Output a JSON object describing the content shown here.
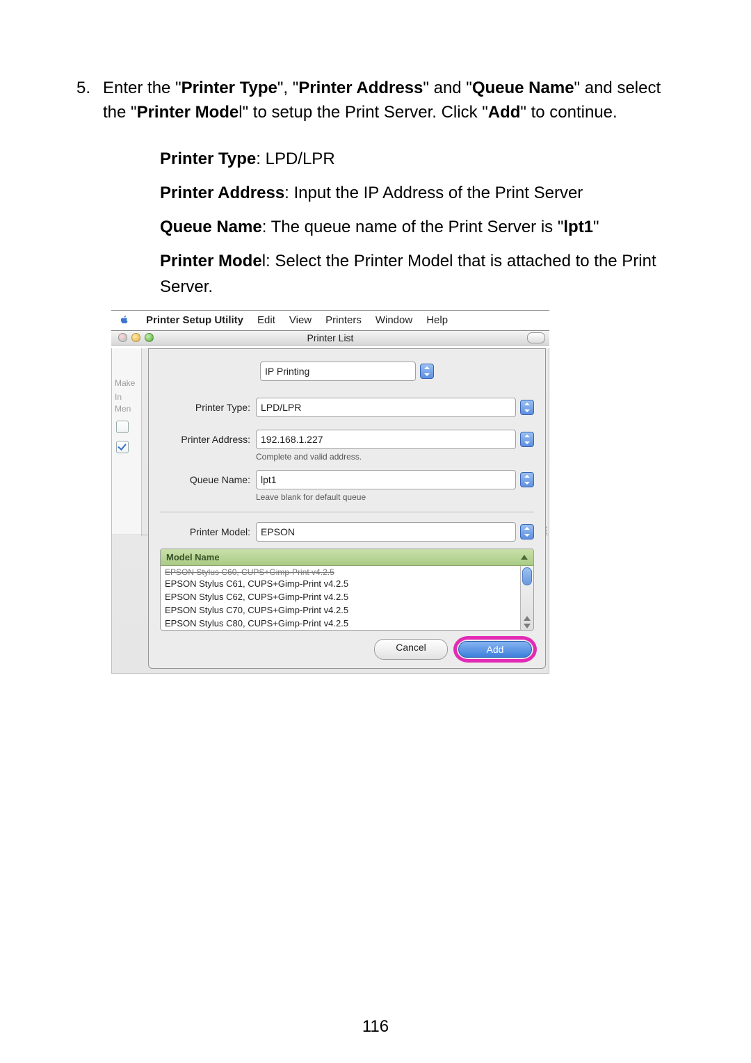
{
  "step": {
    "number": "5.",
    "text_parts": {
      "t0": "Enter the \"",
      "b1": "Printer Type",
      "t1": "\", \"",
      "b2": "Printer Address",
      "t2": "\" and \"",
      "b3": "Queue Name",
      "t3": "\" and select the \"",
      "b4": "Printer Mode",
      "t4": "l\" to setup the Print Server. Click \"",
      "b5": "Add",
      "t5": "\" to continue."
    }
  },
  "defs": {
    "printer_type": {
      "label": "Printer Type",
      "value": ": LPD/LPR"
    },
    "printer_address": {
      "label": "Printer Address",
      "value": ": Input the IP Address of the Print Server"
    },
    "queue_name": {
      "label": "Queue Name",
      "value_a": ": The queue name of the Print Server is \"",
      "value_b": "lpt1",
      "value_c": "\""
    },
    "printer_model": {
      "label": "Printer Mode",
      "value": "l: Select the Printer Model that is attached to the Print Server."
    }
  },
  "menubar": {
    "app": "Printer Setup Utility",
    "items": [
      "Edit",
      "View",
      "Printers",
      "Window",
      "Help"
    ]
  },
  "window_title": "Printer List",
  "sidebar_labels": {
    "make": "Make",
    "in_menu": "In Men"
  },
  "sheet": {
    "top_select": "IP Printing",
    "printer_type_label": "Printer Type:",
    "printer_type_value": "LPD/LPR",
    "printer_address_label": "Printer Address:",
    "printer_address_value": "192.168.1.227",
    "address_hint": "Complete and valid address.",
    "queue_name_label": "Queue Name:",
    "queue_name_value": "lpt1",
    "queue_hint": "Leave blank for default queue",
    "printer_model_label": "Printer Model:",
    "printer_model_value": "EPSON",
    "list_header": "Model Name",
    "list_clip": "EPSON Stylus C60, CUPS+Gimp-Print v4.2.5",
    "list_items": [
      "EPSON Stylus C61, CUPS+Gimp-Print v4.2.5",
      "EPSON Stylus C62, CUPS+Gimp-Print v4.2.5",
      "EPSON Stylus C70, CUPS+Gimp-Print v4.2.5",
      "EPSON Stylus C80, CUPS+Gimp-Print v4.2.5"
    ],
    "cancel": "Cancel",
    "add": "Add"
  },
  "page_number": "116"
}
